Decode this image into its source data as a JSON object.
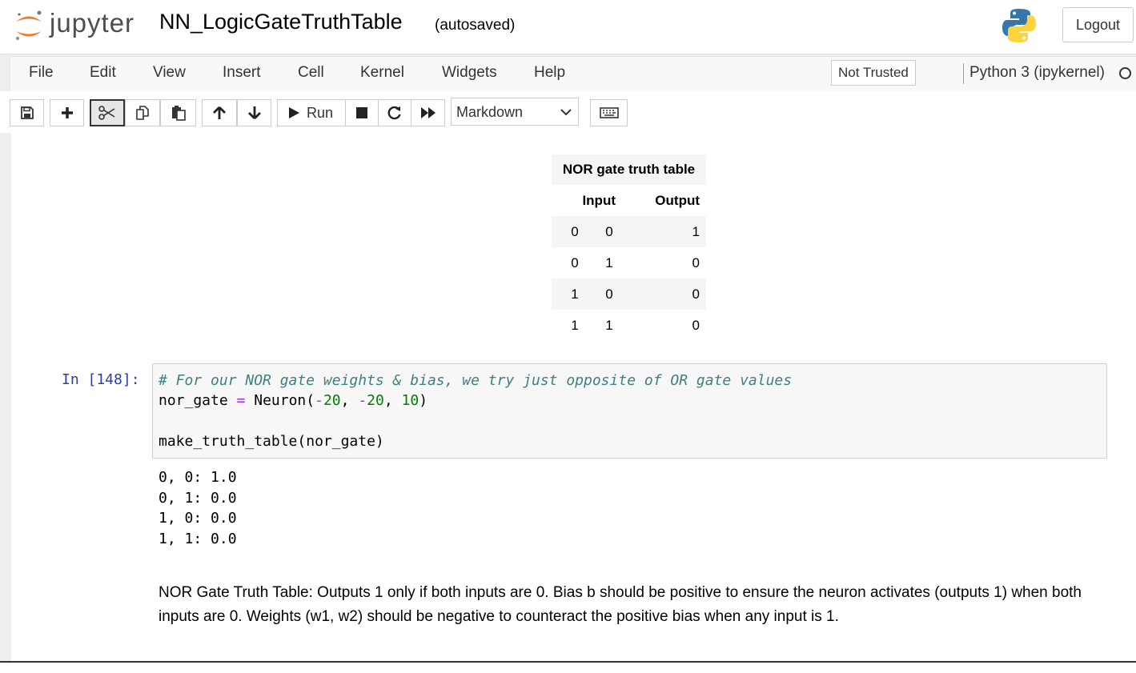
{
  "header": {
    "logo_text": "jupyter",
    "notebook_title": "NN_LogicGateTruthTable",
    "autosave_status": "(autosaved)",
    "logout_label": "Logout"
  },
  "menubar": {
    "items": [
      "File",
      "Edit",
      "View",
      "Insert",
      "Cell",
      "Kernel",
      "Widgets",
      "Help"
    ],
    "trust_status": "Not Trusted",
    "kernel_name": "Python 3 (ipykernel)"
  },
  "toolbar": {
    "run_label": "Run",
    "cell_type": "Markdown",
    "cell_type_options": [
      "Markdown"
    ],
    "icons": [
      "save-icon",
      "plus-icon",
      "scissors-icon",
      "copy-icon",
      "paste-icon",
      "arrow-up-icon",
      "arrow-down-icon",
      "play-icon",
      "stop-icon",
      "restart-icon",
      "fast-forward-icon",
      "keyboard-icon"
    ]
  },
  "truth_table": {
    "caption": "NOR gate truth table",
    "headers": {
      "input": "Input",
      "output": "Output"
    },
    "rows": [
      [
        "0",
        "0",
        "1"
      ],
      [
        "0",
        "1",
        "0"
      ],
      [
        "1",
        "0",
        "0"
      ],
      [
        "1",
        "1",
        "0"
      ]
    ]
  },
  "code_cell": {
    "prompt": "In [148]:",
    "lines": [
      "# For our NOR gate weights & bias, we try just opposite of OR gate values",
      "nor_gate = Neuron(-20, -20, 10)",
      "",
      "make_truth_table(nor_gate)"
    ],
    "output": [
      "0, 0: 1.0",
      "0, 1: 0.0",
      "1, 0: 0.0",
      "1, 1: 0.0"
    ]
  },
  "markdown": {
    "text": "NOR Gate Truth Table: Outputs 1 only if both inputs are 0. Bias b should be positive to ensure the neuron activates (outputs 1) when both inputs are 0. Weights (w1, w2) should be negative to counteract the positive bias when any input is 1."
  },
  "colors": {
    "prompt_blue": "#303f9f",
    "comment": "#408080",
    "operator": "#aa22ff",
    "number": "#008000",
    "jupyter_orange": "#f37726"
  }
}
